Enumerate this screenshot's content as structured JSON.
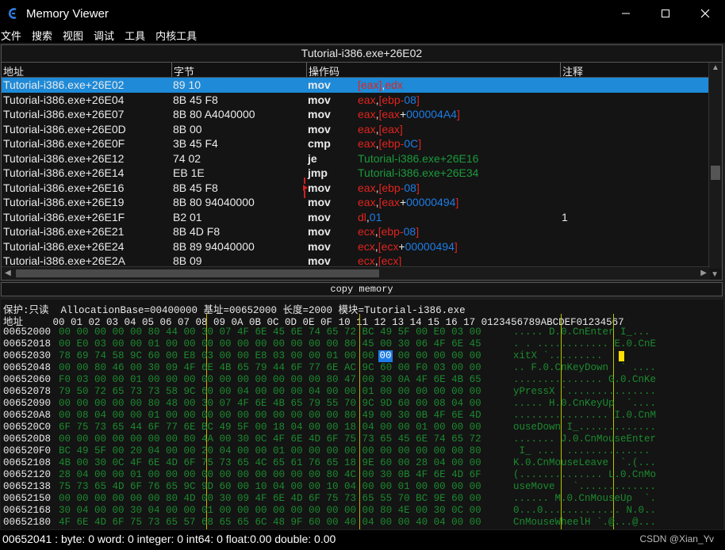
{
  "window": {
    "title": "Memory Viewer"
  },
  "menu": [
    "文件",
    "搜索",
    "视图",
    "调试",
    "工具",
    "内核工具"
  ],
  "disassembler": {
    "title": "Tutorial-i386.exe+26E02",
    "columns": [
      "地址",
      "字节",
      "操作码",
      "注释"
    ],
    "rows": [
      {
        "addr": "Tutorial-i386.exe+26E02",
        "bytes": "89 10",
        "op": "mov",
        "args": [
          [
            "reg",
            "[eax]"
          ],
          [
            "plain",
            ","
          ],
          [
            "reg",
            "edx"
          ]
        ],
        "comment": "",
        "selected": true
      },
      {
        "addr": "Tutorial-i386.exe+26E04",
        "bytes": "8B 45 F8",
        "op": "mov",
        "args": [
          [
            "reg",
            "eax"
          ],
          [
            "plain",
            ","
          ],
          [
            "reg",
            "[ebp-"
          ],
          [
            "num",
            "08"
          ],
          [
            "reg",
            "]"
          ]
        ],
        "comment": ""
      },
      {
        "addr": "Tutorial-i386.exe+26E07",
        "bytes": "8B 80 A4040000",
        "op": "mov",
        "args": [
          [
            "reg",
            "eax"
          ],
          [
            "plain",
            ","
          ],
          [
            "reg",
            "[eax"
          ],
          [
            "plain",
            "+"
          ],
          [
            "num",
            "000004A4"
          ],
          [
            "reg",
            "]"
          ]
        ],
        "comment": ""
      },
      {
        "addr": "Tutorial-i386.exe+26E0D",
        "bytes": "8B 00",
        "op": "mov",
        "args": [
          [
            "reg",
            "eax"
          ],
          [
            "plain",
            ","
          ],
          [
            "reg",
            "[eax]"
          ]
        ],
        "comment": ""
      },
      {
        "addr": "Tutorial-i386.exe+26E0F",
        "bytes": "3B 45 F4",
        "op": "cmp",
        "args": [
          [
            "reg",
            "eax"
          ],
          [
            "plain",
            ","
          ],
          [
            "reg",
            "[ebp-"
          ],
          [
            "num",
            "0C"
          ],
          [
            "reg",
            "]"
          ]
        ],
        "comment": ""
      },
      {
        "addr": "Tutorial-i386.exe+26E12",
        "bytes": "74 02",
        "op": "je",
        "args": [
          [
            "jmp",
            "Tutorial-i386.exe+26E16"
          ]
        ],
        "comment": ""
      },
      {
        "addr": "Tutorial-i386.exe+26E14",
        "bytes": "EB 1E",
        "op": "jmp",
        "args": [
          [
            "jmp",
            "Tutorial-i386.exe+26E34"
          ]
        ],
        "comment": ""
      },
      {
        "addr": "Tutorial-i386.exe+26E16",
        "bytes": "8B 45 F8",
        "op": "mov",
        "args": [
          [
            "reg",
            "eax"
          ],
          [
            "plain",
            ","
          ],
          [
            "reg",
            "[ebp-"
          ],
          [
            "num",
            "08"
          ],
          [
            "reg",
            "]"
          ]
        ],
        "comment": ""
      },
      {
        "addr": "Tutorial-i386.exe+26E19",
        "bytes": "8B 80 94040000",
        "op": "mov",
        "args": [
          [
            "reg",
            "eax"
          ],
          [
            "plain",
            ","
          ],
          [
            "reg",
            "[eax"
          ],
          [
            "plain",
            "+"
          ],
          [
            "num",
            "00000494"
          ],
          [
            "reg",
            "]"
          ]
        ],
        "comment": ""
      },
      {
        "addr": "Tutorial-i386.exe+26E1F",
        "bytes": "B2 01",
        "op": "mov",
        "args": [
          [
            "reg",
            "dl"
          ],
          [
            "plain",
            ","
          ],
          [
            "num",
            "01"
          ]
        ],
        "comment": "1"
      },
      {
        "addr": "Tutorial-i386.exe+26E21",
        "bytes": "8B 4D F8",
        "op": "mov",
        "args": [
          [
            "reg",
            "ecx"
          ],
          [
            "plain",
            ","
          ],
          [
            "reg",
            "[ebp-"
          ],
          [
            "num",
            "08"
          ],
          [
            "reg",
            "]"
          ]
        ],
        "comment": ""
      },
      {
        "addr": "Tutorial-i386.exe+26E24",
        "bytes": "8B 89 94040000",
        "op": "mov",
        "args": [
          [
            "reg",
            "ecx"
          ],
          [
            "plain",
            ","
          ],
          [
            "reg",
            "[ecx"
          ],
          [
            "plain",
            "+"
          ],
          [
            "num",
            "00000494"
          ],
          [
            "reg",
            "]"
          ]
        ],
        "comment": ""
      },
      {
        "addr": "Tutorial-i386.exe+26E2A",
        "bytes": "8B 09",
        "op": "mov",
        "args": [
          [
            "reg",
            "ecx"
          ],
          [
            "plain",
            ","
          ],
          [
            "reg",
            "[ecx]"
          ]
        ],
        "comment": ""
      }
    ]
  },
  "copy_memory": "copy memory",
  "hexview": {
    "info": "保护:只读  AllocationBase=00400000 基址=00652000 长度=2000 模块=Tutorial-i386.exe",
    "header": "地址     00 01 02 03 04 05 06 07 08 09 0A 0B 0C 0D 0E 0F 10 11 12 13 14 15 16 17 0123456789ABCDEF01234567",
    "lines": [
      {
        "addr": "00652000",
        "bytes": "00 00 00 00 00 80 44 00 30 07 4F 6E 45 6E 74 65 72 BC 49 5F 00 E0 03 00",
        "ascii": "..... D.0.CnEnter I_..."
      },
      {
        "addr": "00652018",
        "bytes": "00 E0 03 00 00 01 00 00 00 00 00 00 00 00 00 00 80 45 00 30 06 4F 6E 45",
        "ascii": ". . ............ E.0.CnE"
      },
      {
        "addr": "00652030",
        "bytes": "78 69 74 58 9C 60 00 E8 03 00 00 E8 03 00 00 01 00 00 00 00 00 00 00 00",
        "ascii": "xitX `.........    "
      },
      {
        "addr": "00652048",
        "bytes": "00 00 80 46 00 30 09 4F 6E 4B 65 79 44 6F 77 6E AC 9C 60 00 F0 03 00 00",
        "ascii": ".. F.0.CnKeyDown  ` ...."
      },
      {
        "addr": "00652060",
        "bytes": "F0 03 00 00 01 00 00 00 00 00 00 00 00 00 00 80 47 00 30 0A 4F 6E 4B 65",
        "ascii": "............... G.0.CnKe"
      },
      {
        "addr": "00652078",
        "bytes": "79 50 72 65 73 73 58 9C 60 00 04 00 00 00 04 00 00 01 00 00 00 00 00 00",
        "ascii": "yPressX `..............."
      },
      {
        "addr": "00652090",
        "bytes": "00 00 00 00 00 80 48 00 30 07 4F 6E 4B 65 79 55 70 9C 9D 60 00 08 04 00",
        "ascii": "..... H.0.CnKeyUp  `...."
      },
      {
        "addr": "006520A8",
        "bytes": "00 08 04 00 00 01 00 00 00 00 00 00 00 00 00 00 80 49 00 30 0B 4F 6E 4D",
        "ascii": "................ I.0.CnM"
      },
      {
        "addr": "006520C0",
        "bytes": "6F 75 73 65 44 6F 77 6E BC 49 5F 00 18 04 00 00 18 04 00 00 01 00 00 00",
        "ascii": "ouseDown I_............."
      },
      {
        "addr": "006520D8",
        "bytes": "00 00 00 00 00 00 00 80 4A 00 30 0C 4F 6E 4D 6F 75 73 65 45 6E 74 65 72",
        "ascii": "....... J.0.CnMouseEnter"
      },
      {
        "addr": "006520F0",
        "bytes": "BC 49 5F 00 20 04 00 00 20 04 00 00 01 00 00 00 00 00 00 00 00 00 00 80",
        "ascii": " I_ ...  .............. "
      },
      {
        "addr": "00652108",
        "bytes": "4B 00 30 0C 4F 6E 4D 6F 75 73 65 4C 65 61 76 65 18 9E 60 00 28 04 00 00",
        "ascii": "K.0.CnMouseLeave  `.(..."
      },
      {
        "addr": "00652120",
        "bytes": "28 04 00 00 01 00 00 00 00 00 00 00 00 00 00 80 4C 00 30 0B 4F 6E 4D 6F",
        "ascii": "(.............. L.0.CnMo"
      },
      {
        "addr": "00652138",
        "bytes": "75 73 65 4D 6F 76 65 9C 9D 60 00 10 04 00 00 10 04 00 00 01 00 00 00 00",
        "ascii": "useMove   `............."
      },
      {
        "addr": "00652150",
        "bytes": "00 00 00 00 00 00 80 4D 00 30 09 4F 6E 4D 6F 75 73 65 55 70 BC 9E 60 00",
        "ascii": "...... M.0.CnMouseUp  `."
      },
      {
        "addr": "00652168",
        "bytes": "30 04 00 00 30 04 00 00 01 00 00 00 00 00 00 00 00 00 80 4E 00 30 0C 00",
        "ascii": "0...0............. N.0.."
      },
      {
        "addr": "00652180",
        "bytes": "4F 6E 4D 6F 75 73 65 57 68 65 65 6C 48 9F 60 00 40 04 00 00 40 04 00 00",
        "ascii": "CnMouseWheelH `.@...@..."
      }
    ],
    "selected_byte": "00"
  },
  "statusbar": {
    "text": "00652041 : byte: 0 word: 0 integer: 0 int64: 0 float:0.00 double: 0.00",
    "watermark": "CSDN @Xian_Yv"
  }
}
